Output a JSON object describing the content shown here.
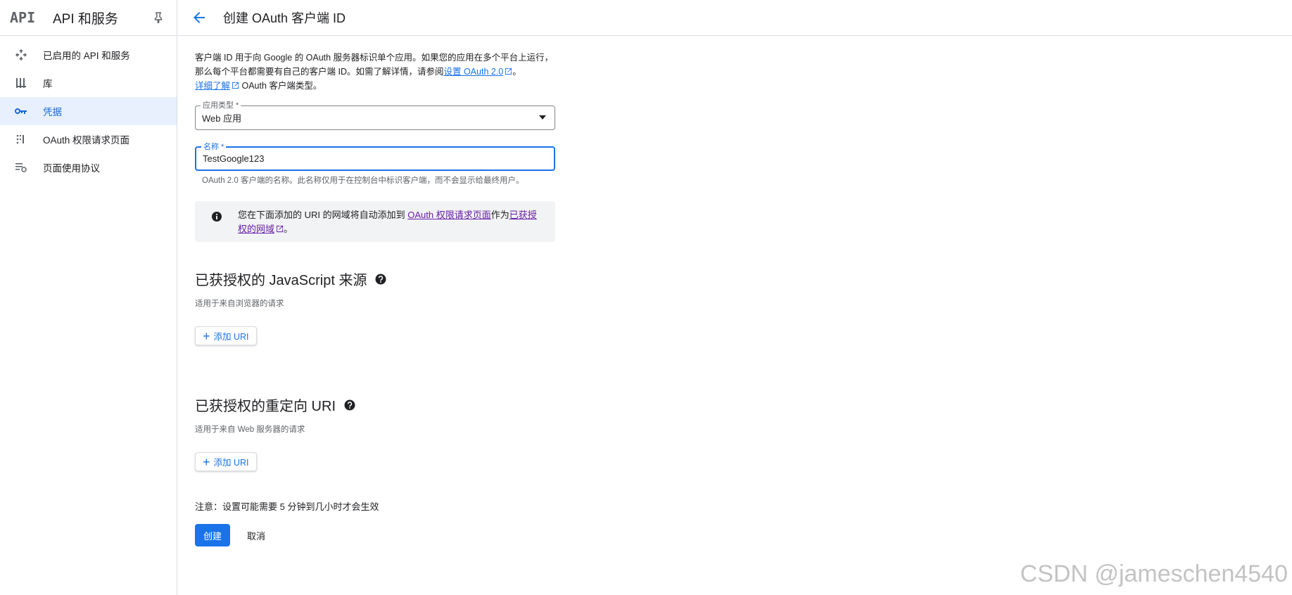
{
  "sidebar": {
    "logo": "API",
    "title": "API 和服务",
    "items": [
      {
        "label": "已启用的 API 和服务",
        "icon": "diamond-arrows-icon",
        "active": false
      },
      {
        "label": "库",
        "icon": "library-icon",
        "active": false
      },
      {
        "label": "凭据",
        "icon": "key-icon",
        "active": true
      },
      {
        "label": "OAuth 权限请求页面",
        "icon": "oauth-consent-icon",
        "active": false
      },
      {
        "label": "页面使用协议",
        "icon": "page-usage-icon",
        "active": false
      }
    ]
  },
  "header": {
    "title": "创建 OAuth 客户端 ID"
  },
  "intro": {
    "text1": "客户端 ID 用于向 Google 的 OAuth 服务器标识单个应用。如果您的应用在多个平台上运行，那么每个平台都需要有自己的客户端 ID。如需了解详情，请参阅",
    "link1": "设置 OAuth 2.0",
    "text2": "。",
    "link2": "详细了解",
    "text3": " OAuth 客户端类型。"
  },
  "form": {
    "app_type_label": "应用类型 *",
    "app_type_value": "Web 应用",
    "name_label": "名称 *",
    "name_value": "TestGoogle123",
    "name_hint": "OAuth 2.0 客户端的名称。此名称仅用于在控制台中标识客户端，而不会显示给最终用户。"
  },
  "info_box": {
    "text1": "您在下面添加的 URI 的网域将自动添加到 ",
    "link1": "OAuth 权限请求页面",
    "text2": "作为",
    "link2": "已获授权的网域",
    "text3": "。"
  },
  "js_origins": {
    "title": "已获授权的 JavaScript 来源",
    "subtitle": "适用于来自浏览器的请求",
    "add_button": "添加 URI"
  },
  "redirect_uris": {
    "title": "已获授权的重定向 URI",
    "subtitle": "适用于来自 Web 服务器的请求",
    "add_button": "添加 URI"
  },
  "footer": {
    "note": "注意：设置可能需要 5 分钟到几小时才会生效",
    "create_button": "创建",
    "cancel_button": "取消"
  },
  "watermark": "CSDN @jameschen4540",
  "colors": {
    "primary": "#1a73e8",
    "active_bg": "#e8f0fe",
    "visited_link": "#681da8"
  }
}
